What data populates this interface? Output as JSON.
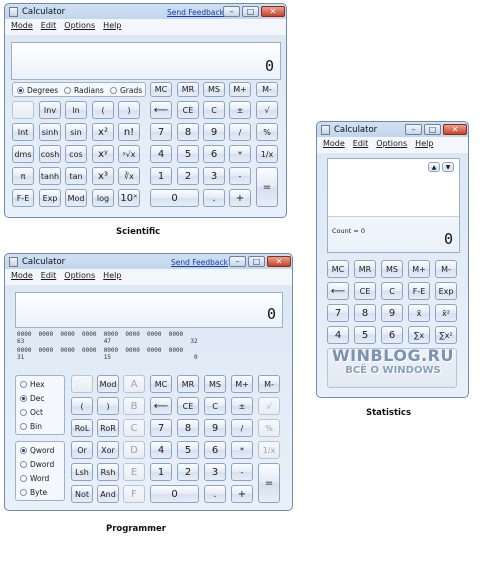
{
  "scientific": {
    "title": "Calculator",
    "feedback": "Send Feedback",
    "menu": [
      "Mode",
      "Edit",
      "Options",
      "Help"
    ],
    "display": "0",
    "angle_options": [
      "Degrees",
      "Radians",
      "Grads"
    ],
    "memory": [
      "MC",
      "MR",
      "MS",
      "M+",
      "M-"
    ],
    "rows": [
      [
        "",
        "Inv",
        "ln",
        "(",
        ")",
        "⟵",
        "CE",
        "C",
        "±",
        "√"
      ],
      [
        "Int",
        "sinh",
        "sin",
        "x²",
        "n!",
        "7",
        "8",
        "9",
        "/",
        "%"
      ],
      [
        "dms",
        "cosh",
        "cos",
        "xʸ",
        "ʸ√x",
        "4",
        "5",
        "6",
        "*",
        "1/x"
      ],
      [
        "π",
        "tanh",
        "tan",
        "x³",
        "∛x",
        "1",
        "2",
        "3",
        "-",
        ""
      ],
      [
        "F-E",
        "Exp",
        "Mod",
        "log",
        "10ˣ",
        "0",
        ".",
        "+",
        "="
      ]
    ],
    "caption": "Scientific"
  },
  "programmer": {
    "title": "Calculator",
    "feedback": "Send Feedback",
    "menu": [
      "Mode",
      "Edit",
      "Options",
      "Help"
    ],
    "display": "0",
    "bit_rows": [
      "0000  0000  0000  0000  0000  0000  0000  0000",
      "63                      47                      32",
      "0000  0000  0000  0000  0000  0000  0000  0000",
      "31                      15                       0"
    ],
    "base_options": [
      "Hex",
      "Dec",
      "Oct",
      "Bin"
    ],
    "word_options": [
      "Qword",
      "Dword",
      "Word",
      "Byte"
    ],
    "rows": [
      [
        "",
        "Mod",
        "A",
        "MC",
        "MR",
        "MS",
        "M+",
        "M-"
      ],
      [
        "(",
        ")",
        "B",
        "⟵",
        "CE",
        "C",
        "±",
        "√"
      ],
      [
        "RoL",
        "RoR",
        "C",
        "7",
        "8",
        "9",
        "/",
        "%"
      ],
      [
        "Or",
        "Xor",
        "D",
        "4",
        "5",
        "6",
        "*",
        "1/x"
      ],
      [
        "Lsh",
        "Rsh",
        "E",
        "1",
        "2",
        "3",
        "-",
        ""
      ],
      [
        "Not",
        "And",
        "F",
        "0",
        ".",
        "+",
        "="
      ]
    ],
    "caption": "Programmer"
  },
  "statistics": {
    "title": "Calculator",
    "menu": [
      "Mode",
      "Edit",
      "Options",
      "Help"
    ],
    "count": "Count = 0",
    "display": "0",
    "rows": [
      [
        "MC",
        "MR",
        "MS",
        "M+",
        "M-"
      ],
      [
        "⟵",
        "CE",
        "C",
        "F-E",
        "Exp"
      ],
      [
        "7",
        "8",
        "9",
        "x̄",
        "x̄²"
      ],
      [
        "4",
        "5",
        "6",
        "∑x",
        "∑x²"
      ]
    ],
    "caption": "Statistics"
  },
  "watermark": {
    "line1": "WINBLOG.RU",
    "line2": "ВСЁ О WINDOWS"
  }
}
